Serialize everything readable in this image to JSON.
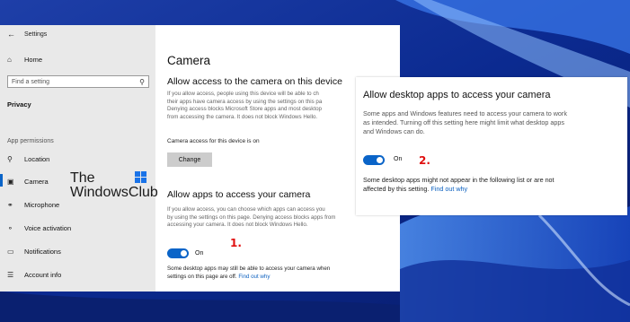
{
  "window": {
    "title": "Settings"
  },
  "sidebar": {
    "home_label": "Home",
    "search_placeholder": "Find a setting",
    "section_title": "Privacy",
    "group_label": "App permissions",
    "items": [
      {
        "label": "Location",
        "icon": "location-icon"
      },
      {
        "label": "Camera",
        "icon": "camera-icon",
        "selected": true
      },
      {
        "label": "Microphone",
        "icon": "microphone-icon"
      },
      {
        "label": "Voice activation",
        "icon": "voice-activation-icon"
      },
      {
        "label": "Notifications",
        "icon": "notifications-icon"
      },
      {
        "label": "Account info",
        "icon": "account-info-icon"
      }
    ]
  },
  "watermark": {
    "line1": "The",
    "line2": "WindowsClub"
  },
  "main": {
    "page_title": "Camera",
    "device_section": {
      "heading": "Allow access to the camera on this device",
      "desc_lines": [
        "If you allow access, people using this device will be able to ch",
        "their apps have camera access by using the settings on this pa",
        "Denying access blocks Microsoft Store apps and most desktop",
        "from accessing the camera. It does not block Windows Hello."
      ],
      "status": "Camera access for this device is on",
      "change_button": "Change"
    },
    "apps_section": {
      "heading": "Allow apps to access your camera",
      "desc_lines": [
        "If you allow access, you can choose which apps can access you",
        "by using the settings on this page. Denying access blocks apps from",
        "accessing your camera. It does not block Windows Hello."
      ],
      "toggle_label": "On",
      "toggle_on": true,
      "note_lines": [
        "Some desktop apps may still be able to access your camera when",
        "settings on this page are off."
      ],
      "link": "Find out why"
    }
  },
  "overlay": {
    "heading": "Allow desktop apps to access your camera",
    "desc_lines": [
      "Some apps and Windows features need to access your camera to work",
      "as intended. Turning off this setting here might limit what desktop apps",
      "and Windows can do."
    ],
    "toggle_label": "On",
    "toggle_on": true,
    "note_lines": [
      "Some desktop apps might not appear in the following list or are not",
      "affected by this setting."
    ],
    "link": "Find out why"
  },
  "annotations": {
    "marker1": "1.",
    "marker2": "2."
  },
  "colors": {
    "accent": "#0a64c8",
    "annotation": "#e01010",
    "link": "#0a5fbf"
  }
}
